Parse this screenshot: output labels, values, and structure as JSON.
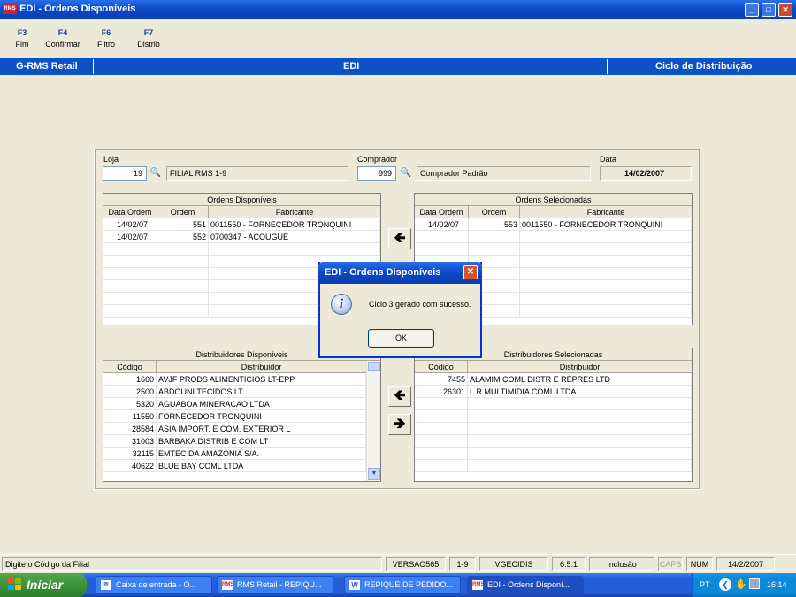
{
  "window": {
    "icon_text": "RMS",
    "title": "EDI - Ordens Disponíveis",
    "minimize": "_",
    "maximize": "□",
    "close": "✕"
  },
  "fkeys": [
    {
      "key": "F3",
      "label": "Fim"
    },
    {
      "key": "F4",
      "label": "Confirmar"
    },
    {
      "key": "F6",
      "label": "Filtro"
    },
    {
      "key": "F7",
      "label": "Distrib"
    }
  ],
  "header": {
    "left": "G-RMS Retail",
    "center": "EDI",
    "right": "Ciclo de Distribuição"
  },
  "form": {
    "loja_label": "Loja",
    "loja_value": "19",
    "loja_name": "FILIAL RMS 1-9",
    "comprador_label": "Comprador",
    "comprador_value": "999",
    "comprador_name": "Comprador Padrão",
    "data_label": "Data",
    "data_value": "14/02/2007"
  },
  "ordens_disponiveis": {
    "caption": "Ordens Disponíveis",
    "columns": [
      "Data Ordem",
      "Ordem",
      "Fabricante"
    ],
    "rows": [
      {
        "data": "14/02/07",
        "ordem": "551",
        "fabricante": "0011550 - FORNECEDOR TRONQUINI"
      },
      {
        "data": "14/02/07",
        "ordem": "552",
        "fabricante": "0700347 - ACOUGUE"
      }
    ]
  },
  "ordens_selecionadas": {
    "caption": "Ordens Selecionadas",
    "columns": [
      "Data Ordem",
      "Ordem",
      "Fabricante"
    ],
    "rows": [
      {
        "data": "14/02/07",
        "ordem": "553",
        "fabricante": "0011550 - FORNECEDOR TRONQUINI"
      }
    ]
  },
  "distribuidores_disponiveis": {
    "caption": "Distribuidores Disponíveis",
    "columns": [
      "Código",
      "Distribuidor"
    ],
    "rows": [
      {
        "codigo": "1660",
        "nome": "AVJF PRODS ALIMENTICIOS LT-EPP"
      },
      {
        "codigo": "2500",
        "nome": "ABDOUNI TECIDOS LT"
      },
      {
        "codigo": "5320",
        "nome": "AGUABOA MINERACAO LTDA"
      },
      {
        "codigo": "11550",
        "nome": "FORNECEDOR TRONQUINI"
      },
      {
        "codigo": "28584",
        "nome": "ASIA IMPORT. E COM. EXTERIOR L"
      },
      {
        "codigo": "31003",
        "nome": "BARBAKA DISTRIB E COM LT"
      },
      {
        "codigo": "32115",
        "nome": "EMTEC DA AMAZONIA S/A."
      },
      {
        "codigo": "40622",
        "nome": "BLUE BAY COML LTDA"
      }
    ]
  },
  "distribuidores_selecionados": {
    "caption": "Distribuidores Selecionadas",
    "columns": [
      "Código",
      "Distribuidor"
    ],
    "rows": [
      {
        "codigo": "7455",
        "nome": "ALAMIM COML DISTR E REPRES LTD"
      },
      {
        "codigo": "26301",
        "nome": "L.R MULTIMIDIA COML LTDA."
      }
    ]
  },
  "buttons": {
    "move_left": "🡸",
    "move_right": "🡺",
    "binoculars": "🔍"
  },
  "dialog": {
    "title": "EDI - Ordens Disponíveis",
    "close": "✕",
    "icon": "i",
    "message": "Ciclo 3 gerado com sucesso.",
    "ok": "OK"
  },
  "statusbar": {
    "hint": "Digite o Código da Filial",
    "version": "VERSAO565",
    "loja": "1-9",
    "user": "VGECIDIS",
    "build": "6.5.1",
    "mode": "Inclusão",
    "caps": "CAPS",
    "num": "NUM",
    "date": "14/2/2007"
  },
  "taskbar": {
    "start": "Iniciar",
    "items": [
      {
        "label": "Caixa de entrada - O...",
        "active": false
      },
      {
        "label": "RMS Retail - REPIQU...",
        "active": false
      },
      {
        "label": "REPIQUE DE PEDIDO...",
        "active": false
      },
      {
        "label": "EDI - Ordens Disponí...",
        "active": true
      }
    ],
    "lang": "PT",
    "clock": "16:14"
  }
}
